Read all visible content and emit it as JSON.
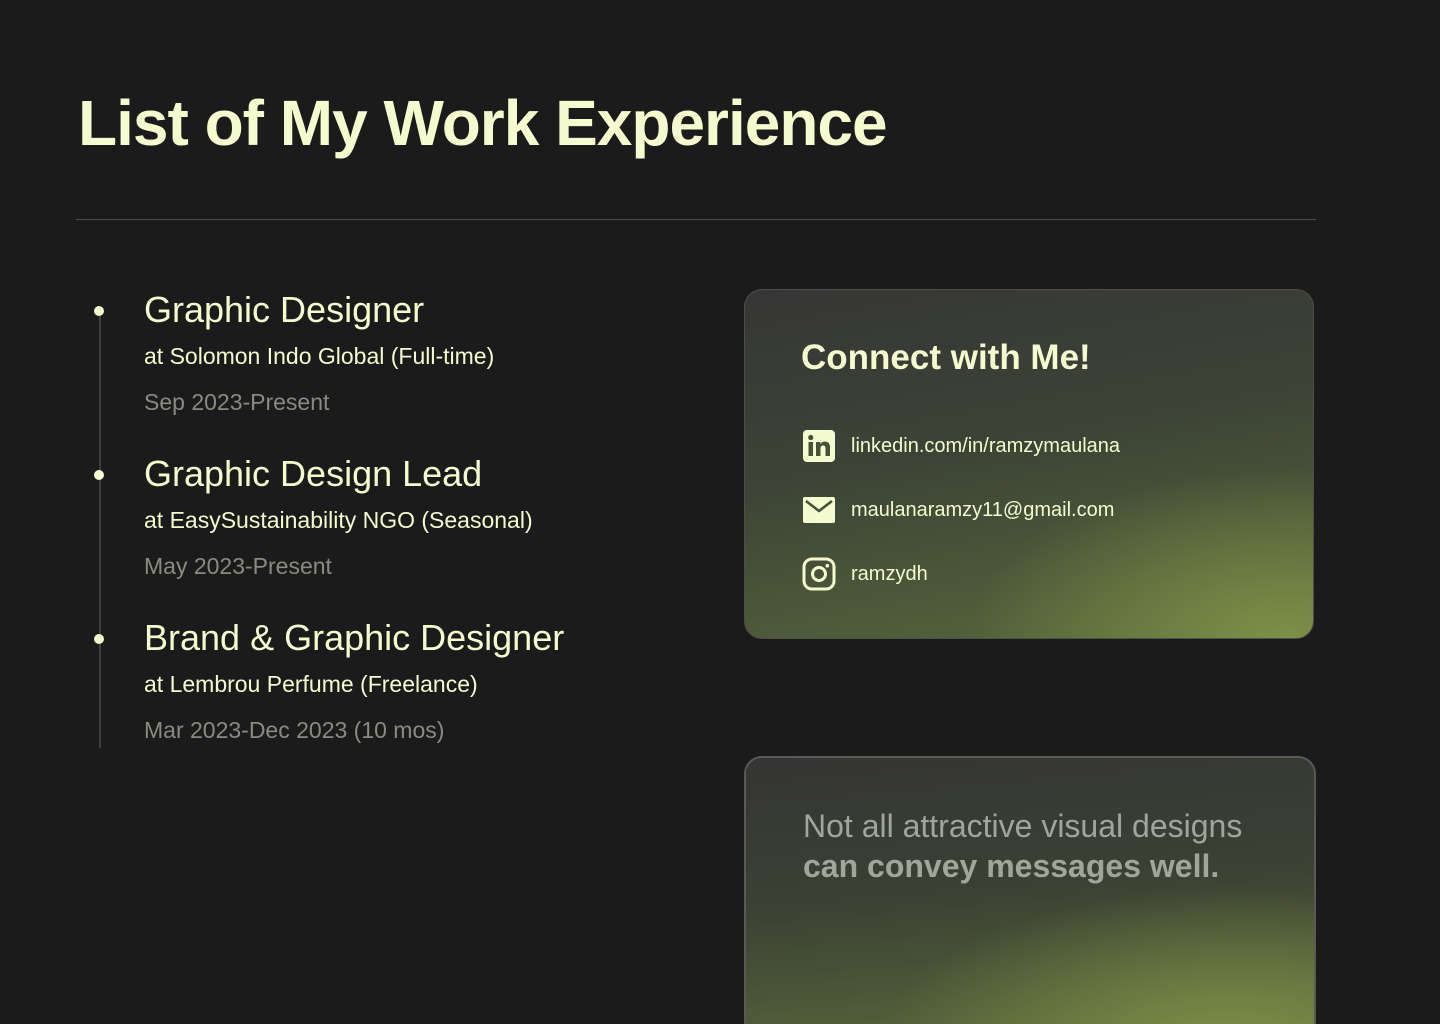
{
  "header": {
    "title": "List of My Work Experience"
  },
  "experience": [
    {
      "title": "Graphic Designer",
      "company": "at Solomon Indo Global (Full-time)",
      "period": "Sep 2023-Present"
    },
    {
      "title": "Graphic Design Lead",
      "company": "at EasySustainability NGO (Seasonal)",
      "period": "May 2023-Present"
    },
    {
      "title": "Brand & Graphic Designer",
      "company": "at Lembrou Perfume (Freelance)",
      "period": "Mar 2023-Dec 2023 (10 mos)"
    }
  ],
  "connect": {
    "title": "Connect with Me!",
    "linkedin": {
      "icon": "linkedin-icon",
      "text": "linkedin.com/in/ramzymaulana"
    },
    "email": {
      "icon": "mail-icon",
      "text": "maulanaramzy11@gmail.com"
    },
    "instagram": {
      "icon": "instagram-icon",
      "text": "ramzydh"
    }
  },
  "quote": {
    "line1": "Not all attractive visual designs",
    "line2": "can convey messages well."
  },
  "colors": {
    "background": "#1b1b1b",
    "accent_text": "#f4fbcf",
    "muted_text": "#8a8a82",
    "card_green": "#7e9248"
  }
}
